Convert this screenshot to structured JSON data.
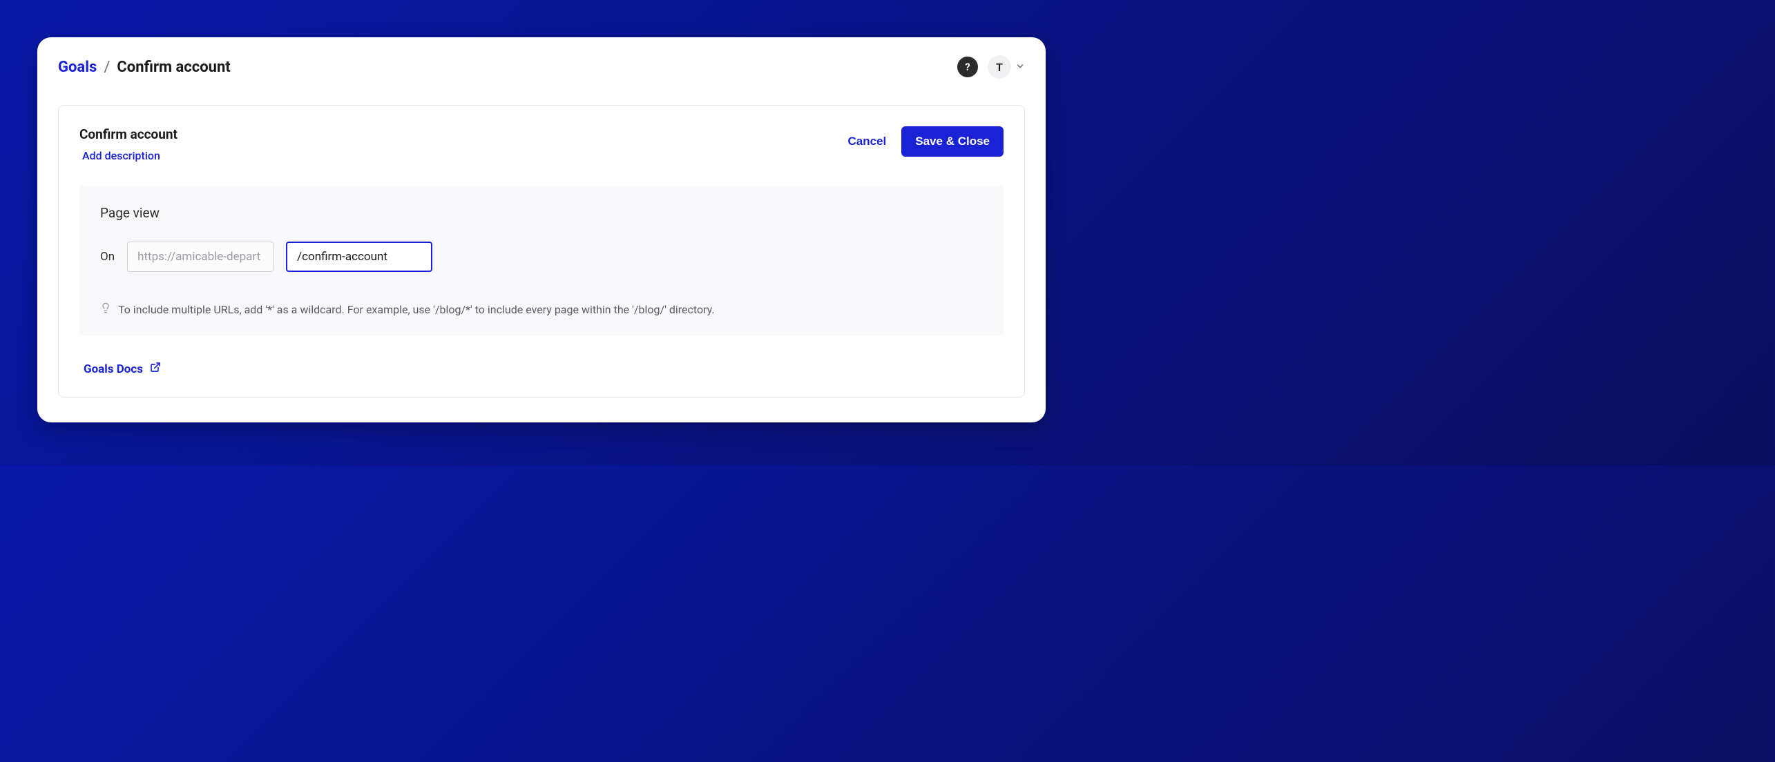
{
  "breadcrumb": {
    "root": "Goals",
    "separator": "/",
    "current": "Confirm account"
  },
  "header": {
    "help_label": "?",
    "avatar_initial": "T"
  },
  "section": {
    "title": "Confirm account",
    "add_description": "Add description",
    "cancel": "Cancel",
    "save": "Save & Close"
  },
  "pageview": {
    "title": "Page view",
    "on_label": "On",
    "domain_placeholder": "https://amicable-depart",
    "path_value": "/confirm-account",
    "hint": "To include multiple URLs, add '*' as a wildcard. For example, use '/blog/*' to include every page within the '/blog/' directory."
  },
  "footer": {
    "docs_label": "Goals Docs"
  }
}
